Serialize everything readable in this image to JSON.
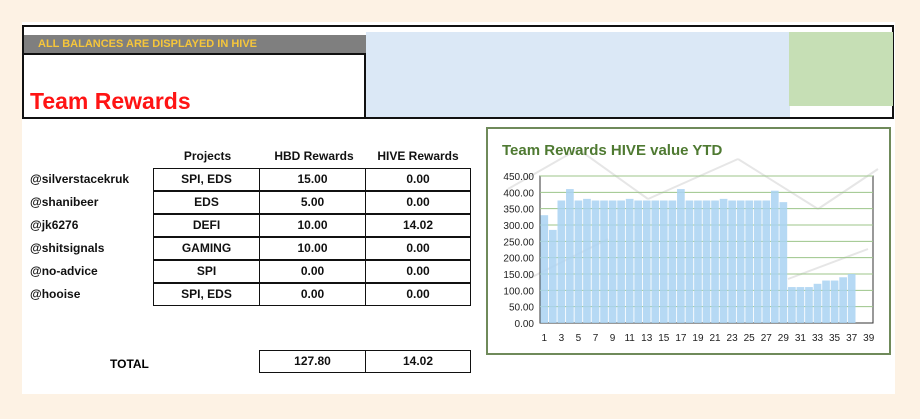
{
  "banner": "ALL BALANCES ARE DISPLAYED IN HIVE",
  "title": "Team Rewards",
  "headers": {
    "projects": "Projects",
    "hbd": "HBD Rewards",
    "hive": "HIVE Rewards"
  },
  "rows": [
    {
      "handle": "@silverstacekruk",
      "projects": "SPI, EDS",
      "hbd": "15.00",
      "hive": "0.00"
    },
    {
      "handle": "@shanibeer",
      "projects": "EDS",
      "hbd": "5.00",
      "hive": "0.00"
    },
    {
      "handle": "@jk6276",
      "projects": "DEFI",
      "hbd": "10.00",
      "hive": "14.02"
    },
    {
      "handle": "@shitsignals",
      "projects": "GAMING",
      "hbd": "10.00",
      "hive": "0.00"
    },
    {
      "handle": "@no-advice",
      "projects": "SPI",
      "hbd": "0.00",
      "hive": "0.00"
    },
    {
      "handle": "@hooise",
      "projects": "SPI, EDS",
      "hbd": "0.00",
      "hive": "0.00"
    }
  ],
  "total": {
    "label": "TOTAL",
    "hbd": "127.80",
    "hive": "14.02"
  },
  "colors": {
    "title": "#ff1414",
    "banner_text": "#f6c63a",
    "bar": "#a9d2f2",
    "chart_title": "#4f7a32"
  },
  "chart_data": {
    "type": "bar",
    "title": "Team Rewards HIVE value YTD",
    "ylim": [
      0,
      450
    ],
    "yticks": [
      "0.00",
      "50.00",
      "100.00",
      "150.00",
      "200.00",
      "250.00",
      "300.00",
      "350.00",
      "400.00",
      "450.00"
    ],
    "xticks": [
      "1",
      "3",
      "5",
      "7",
      "9",
      "11",
      "13",
      "15",
      "17",
      "19",
      "21",
      "23",
      "25",
      "27",
      "29",
      "31",
      "33",
      "35",
      "37",
      "39"
    ],
    "x": [
      1,
      2,
      3,
      4,
      5,
      6,
      7,
      8,
      9,
      10,
      11,
      12,
      13,
      14,
      15,
      16,
      17,
      18,
      19,
      20,
      21,
      22,
      23,
      24,
      25,
      26,
      27,
      28,
      29,
      30,
      31,
      32,
      33,
      34,
      35,
      36,
      37,
      38
    ],
    "values": [
      330,
      285,
      375,
      410,
      375,
      380,
      375,
      375,
      375,
      375,
      380,
      375,
      375,
      375,
      375,
      375,
      410,
      375,
      375,
      375,
      375,
      380,
      375,
      375,
      375,
      375,
      375,
      405,
      370,
      110,
      110,
      110,
      120,
      130,
      130,
      140,
      150,
      0
    ],
    "grid": true
  }
}
